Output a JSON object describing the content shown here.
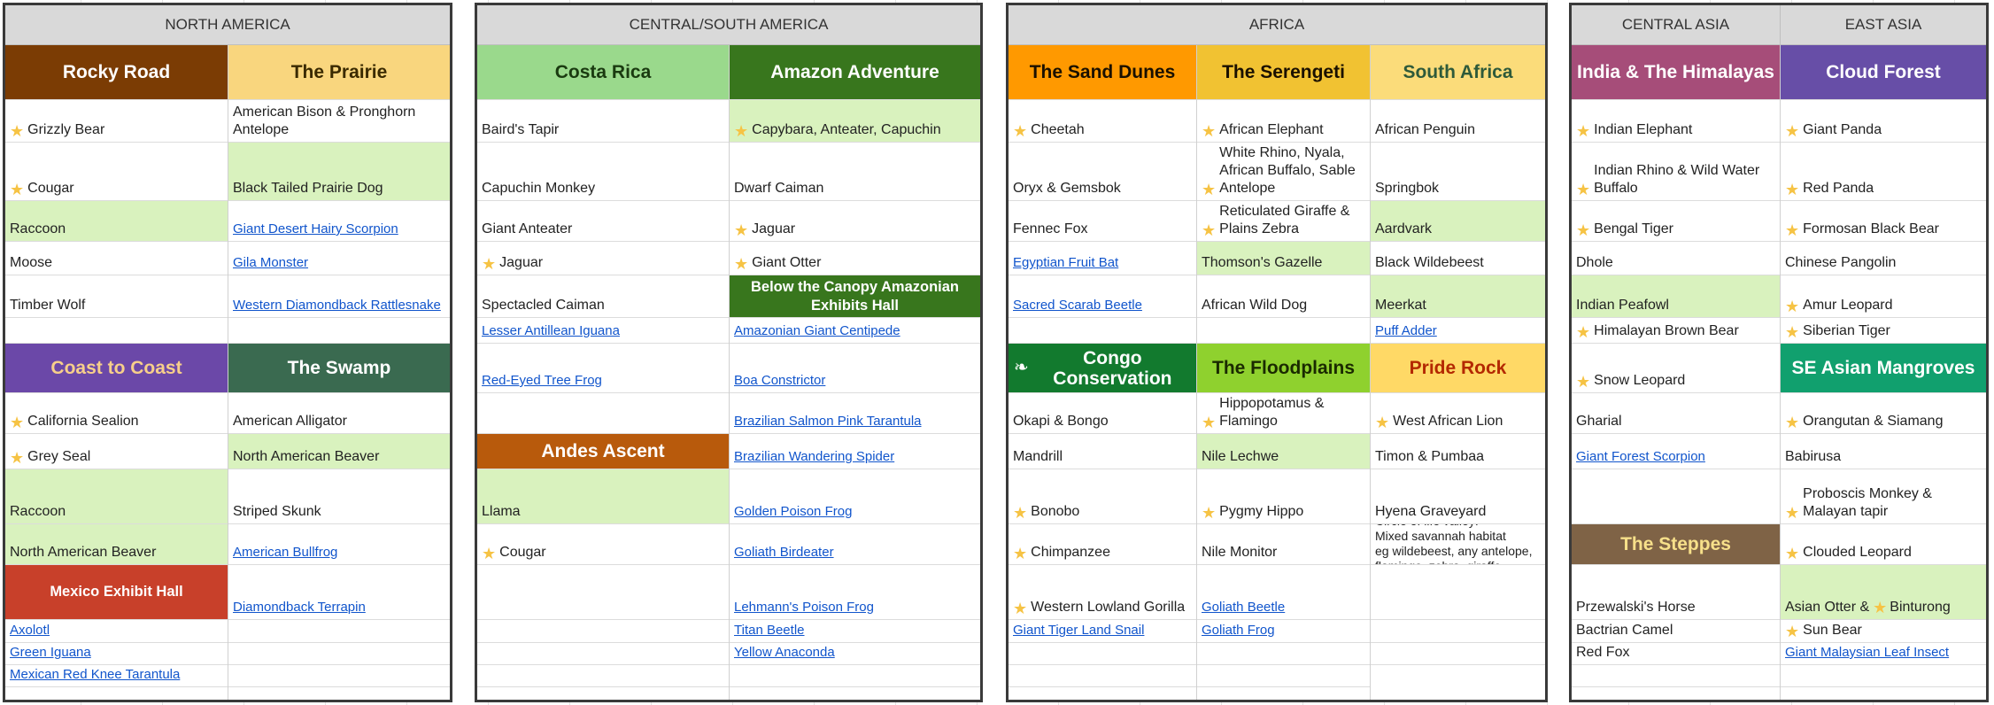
{
  "regions": [
    {
      "name": "NORTH AMERICA",
      "headers": [
        "NORTH AMERICA"
      ],
      "columns": [
        {
          "cells": [
            {
              "text": "Rocky Road",
              "kind": "head",
              "bg": "#7b3c04",
              "fg": "#ffffff"
            },
            {
              "text": "Grizzly Bear",
              "star": true
            },
            {
              "text": "Cougar",
              "star": true
            },
            {
              "text": "Raccoon",
              "hl": true
            },
            {
              "text": "Moose"
            },
            {
              "text": "Timber Wolf"
            },
            {
              "text": ""
            },
            {
              "text": "Coast to Coast",
              "kind": "head",
              "bg": "#6b48a8",
              "fg": "#f7cf8a"
            },
            {
              "text": "California Sealion",
              "star": true
            },
            {
              "text": "Grey Seal",
              "star": true
            },
            {
              "text": "Raccoon",
              "hl": true
            },
            {
              "text": "North American Beaver",
              "hl": true
            },
            {
              "text": "Mexico Exhibit Hall",
              "kind": "head",
              "small": true,
              "bg": "#c8402a",
              "fg": "#ffffff"
            },
            {
              "text": "Axolotl",
              "link": true
            },
            {
              "text": "Green Iguana",
              "link": true
            },
            {
              "text": "Mexican Red Knee Tarantula",
              "link": true
            }
          ]
        },
        {
          "cells": [
            {
              "text": "The Prairie",
              "kind": "head",
              "bg": "#f9d67e",
              "fg": "#3a2a00"
            },
            {
              "text": "American Bison & Pronghorn Antelope"
            },
            {
              "text": "Black Tailed Prairie Dog",
              "hl": true
            },
            {
              "text": "Giant Desert Hairy Scorpion",
              "link": true
            },
            {
              "text": "Gila Monster",
              "link": true
            },
            {
              "text": "Western Diamondback Rattlesnake",
              "link": true
            },
            {
              "text": ""
            },
            {
              "text": "The Swamp",
              "kind": "head",
              "bg": "#3a6a50",
              "fg": "#ffffff"
            },
            {
              "text": "American Alligator"
            },
            {
              "text": "North American Beaver",
              "hl": true
            },
            {
              "text": "Striped Skunk"
            },
            {
              "text": "American Bullfrog",
              "link": true
            },
            {
              "text": "Diamondback Terrapin",
              "link": true
            },
            {
              "text": ""
            },
            {
              "text": ""
            },
            {
              "text": ""
            }
          ]
        }
      ]
    },
    {
      "name": "CENTRAL/SOUTH AMERICA",
      "headers": [
        "CENTRAL/SOUTH AMERICA"
      ],
      "columns": [
        {
          "cells": [
            {
              "text": "Costa Rica",
              "kind": "head",
              "bg": "#9ad98c",
              "fg": "#1a3a10"
            },
            {
              "text": "Baird's Tapir"
            },
            {
              "text": "Capuchin Monkey"
            },
            {
              "text": "Giant Anteater"
            },
            {
              "text": "Jaguar",
              "star": true
            },
            {
              "text": "Spectacled Caiman"
            },
            {
              "text": "Lesser Antillean Iguana",
              "link": true
            },
            {
              "text": "Red-Eyed Tree Frog",
              "link": true
            },
            {
              "text": ""
            },
            {
              "text": "Andes Ascent",
              "kind": "head",
              "bg": "#b85a0c",
              "fg": "#ffffff"
            },
            {
              "text": "Llama",
              "hl": true
            },
            {
              "text": "Cougar",
              "star": true
            },
            {
              "text": ""
            },
            {
              "text": ""
            },
            {
              "text": ""
            },
            {
              "text": ""
            }
          ]
        },
        {
          "cells": [
            {
              "text": "Amazon Adventure",
              "kind": "head",
              "bg": "#38761d",
              "fg": "#ffffff"
            },
            {
              "text": "Capybara, Anteater, Capuchin",
              "star": true,
              "hl": true
            },
            {
              "text": "Dwarf Caiman"
            },
            {
              "text": "Jaguar",
              "star": true
            },
            {
              "text": "Giant Otter",
              "star": true
            },
            {
              "text": "Below the Canopy Amazonian Exhibits Hall",
              "kind": "head",
              "small": true,
              "bg": "#38761d",
              "fg": "#ffffff"
            },
            {
              "text": "Amazonian Giant Centipede",
              "link": true
            },
            {
              "text": "Boa Constrictor",
              "link": true
            },
            {
              "text": "Brazilian Salmon Pink Tarantula",
              "link": true
            },
            {
              "text": "Brazilian Wandering Spider",
              "link": true
            },
            {
              "text": "Golden Poison Frog",
              "link": true
            },
            {
              "text": "Goliath Birdeater",
              "link": true
            },
            {
              "text": "Lehmann's Poison Frog",
              "link": true
            },
            {
              "text": "Titan Beetle",
              "link": true
            },
            {
              "text": "Yellow Anaconda",
              "link": true
            },
            {
              "text": ""
            }
          ]
        }
      ]
    },
    {
      "name": "AFRICA",
      "headers": [
        "AFRICA"
      ],
      "columns": [
        {
          "cells": [
            {
              "text": "The Sand Dunes",
              "kind": "head",
              "bg": "#ff9900",
              "fg": "#1a1000"
            },
            {
              "text": "Cheetah",
              "star": true
            },
            {
              "text": "Oryx & Gemsbok"
            },
            {
              "text": "Fennec Fox"
            },
            {
              "text": "Egyptian Fruit Bat",
              "link": true
            },
            {
              "text": "Sacred Scarab Beetle",
              "link": true
            },
            {
              "text": ""
            },
            {
              "text": "Congo Conservation",
              "kind": "head",
              "leaf": true,
              "bg": "#127a2e",
              "fg": "#ffffff"
            },
            {
              "text": "Okapi & Bongo"
            },
            {
              "text": "Mandrill"
            },
            {
              "text": "Bonobo",
              "star": true
            },
            {
              "text": "Chimpanzee",
              "star": true
            },
            {
              "text": "Western Lowland Gorilla",
              "star": true
            },
            {
              "text": "Giant Tiger Land Snail",
              "link": true
            },
            {
              "text": ""
            },
            {
              "text": ""
            }
          ]
        },
        {
          "cells": [
            {
              "text": "The Serengeti",
              "kind": "head",
              "bg": "#f1c232",
              "fg": "#1a1000"
            },
            {
              "text": "African Elephant",
              "star": true
            },
            {
              "text": "White Rhino, Nyala, African Buffalo, Sable Antelope",
              "star": true
            },
            {
              "text": "Reticulated Giraffe & Plains Zebra",
              "star": true
            },
            {
              "text": "Thomson's Gazelle",
              "hl": true
            },
            {
              "text": "African Wild Dog"
            },
            {
              "text": ""
            },
            {
              "text": "The Floodplains",
              "kind": "head",
              "bg": "#8fd12e",
              "fg": "#1a2a00"
            },
            {
              "text": "Hippopotamus & Flamingo",
              "star": true
            },
            {
              "text": "Nile Lechwe",
              "hl": true
            },
            {
              "text": "Pygmy Hippo",
              "star": true
            },
            {
              "text": "Nile Monitor"
            },
            {
              "text": "Goliath Beetle",
              "link": true
            },
            {
              "text": "Goliath Frog",
              "link": true
            },
            {
              "text": ""
            },
            {
              "text": ""
            }
          ]
        },
        {
          "cells": [
            {
              "text": "South Africa",
              "kind": "head",
              "bg": "#fbdc7a",
              "fg": "#2e5a3a"
            },
            {
              "text": "African Penguin"
            },
            {
              "text": "Springbok"
            },
            {
              "text": "Aardvark",
              "hl": true
            },
            {
              "text": "Black Wildebeest"
            },
            {
              "text": "Meerkat",
              "hl": true
            },
            {
              "text": "Puff Adder",
              "link": true
            },
            {
              "text": "Pride Rock",
              "kind": "head",
              "bg": "#ffd966",
              "fg": "#b32800"
            },
            {
              "text": "West African Lion",
              "star": true
            },
            {
              "text": "Timon & Pumbaa"
            },
            {
              "text": "Hyena Graveyard"
            },
            {
              "text": "Circle of life valley:\nMixed savannah habitat\neg wildebeest, any antelope, flamingo, zebra, giraffe",
              "note": true
            },
            {
              "text": ""
            },
            {
              "text": ""
            },
            {
              "text": ""
            }
          ]
        }
      ]
    },
    {
      "name": "ASIA",
      "headers": [
        "CENTRAL ASIA",
        "EAST ASIA"
      ],
      "columns": [
        {
          "cells": [
            {
              "text": "India & The Himalayas",
              "kind": "head",
              "bg": "#a64d79",
              "fg": "#ffffff"
            },
            {
              "text": "Indian Elephant",
              "star": true
            },
            {
              "text": "Indian Rhino & Wild Water Buffalo",
              "star": true
            },
            {
              "text": "Bengal Tiger",
              "star": true
            },
            {
              "text": "Dhole"
            },
            {
              "text": "Indian Peafowl",
              "hl": true
            },
            {
              "text": "Himalayan Brown Bear",
              "star": true
            },
            {
              "text": "Snow Leopard",
              "star": true
            },
            {
              "text": "Gharial"
            },
            {
              "text": "Giant Forest Scorpion",
              "link": true
            },
            {
              "text": ""
            },
            {
              "text": "The Steppes",
              "kind": "head",
              "bg": "#7f6346",
              "fg": "#f7e08a"
            },
            {
              "text": "Przewalski's Horse"
            },
            {
              "text": "Bactrian Camel"
            },
            {
              "text": "Red Fox"
            },
            {
              "text": ""
            }
          ]
        },
        {
          "cells": [
            {
              "text": "Cloud Forest",
              "kind": "head",
              "bg": "#674ea7",
              "fg": "#ffffff"
            },
            {
              "text": "Giant Panda",
              "star": true
            },
            {
              "text": "Red Panda",
              "star": true
            },
            {
              "text": "Formosan Black Bear",
              "star": true
            },
            {
              "text": "Chinese Pangolin"
            },
            {
              "text": "Amur Leopard",
              "star": true
            },
            {
              "text": "Siberian Tiger",
              "star": true
            },
            {
              "text": "SE Asian Mangroves",
              "kind": "head",
              "bg": "#11a06e",
              "fg": "#ffffff"
            },
            {
              "text": "Orangutan & Siamang",
              "star": true
            },
            {
              "text": "Babirusa"
            },
            {
              "text": "Proboscis Monkey & Malayan tapir",
              "star": true
            },
            {
              "text": "Clouded Leopard",
              "star": true
            },
            {
              "text": "Asian Otter & ",
              "star_after": "Binturong",
              "hl": true
            },
            {
              "text": "Sun Bear",
              "star": true
            },
            {
              "text": "Giant Malaysian Leaf Insect",
              "link": true
            },
            {
              "text": ""
            }
          ]
        }
      ]
    }
  ]
}
